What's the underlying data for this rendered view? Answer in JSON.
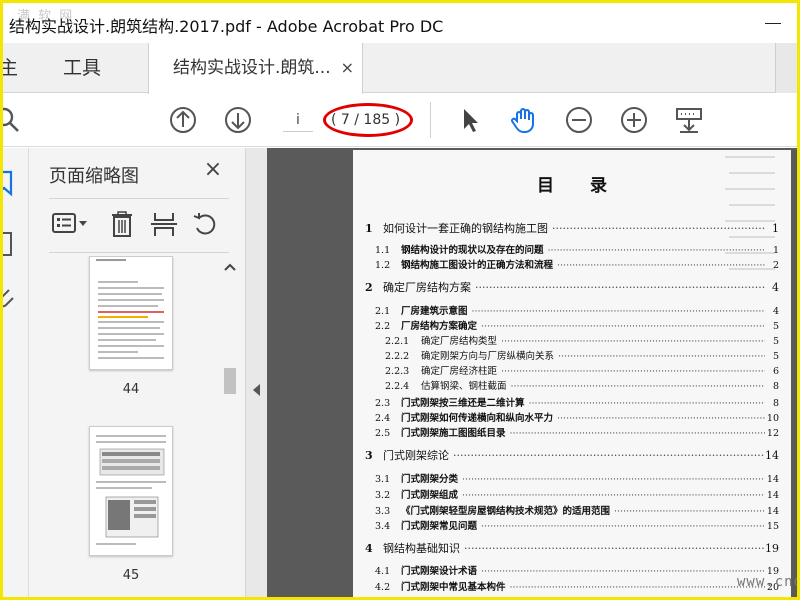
{
  "window": {
    "title": "结构实战设计.朗筑结构.2017.pdf - Adobe Acrobat Pro DC",
    "watermark": "满 软 网"
  },
  "tabs": {
    "home": "主页",
    "tools": "工具",
    "document": "结构实战设计.朗筑...",
    "close_glyph": "×"
  },
  "toolbar": {
    "page_input": "i",
    "page_count": "( 7 / 185 )"
  },
  "thumbnails": {
    "panel_title": "页面缩略图",
    "close_glyph": "×",
    "pages": [
      {
        "number": "44"
      },
      {
        "number": "45"
      }
    ]
  },
  "document": {
    "heading": "目录",
    "toc": [
      {
        "num": "1",
        "text": "如何设计一套正确的钢结构施工图",
        "page": "1",
        "level": 0
      },
      {
        "num": "1.1",
        "text": "钢结构设计的现状以及存在的问题",
        "page": "1",
        "level": 1
      },
      {
        "num": "1.2",
        "text": "钢结构施工图设计的正确方法和流程",
        "page": "2",
        "level": 1
      },
      {
        "num": "2",
        "text": "确定厂房结构方案",
        "page": "4",
        "level": 0
      },
      {
        "num": "2.1",
        "text": "厂房建筑示意图",
        "page": "4",
        "level": 1
      },
      {
        "num": "2.2",
        "text": "厂房结构方案确定",
        "page": "5",
        "level": 1
      },
      {
        "num": "2.2.1",
        "text": "确定厂房结构类型",
        "page": "5",
        "level": 2
      },
      {
        "num": "2.2.2",
        "text": "确定刚架方向与厂房纵横向关系",
        "page": "5",
        "level": 2
      },
      {
        "num": "2.2.3",
        "text": "确定厂房经济柱距",
        "page": "6",
        "level": 2
      },
      {
        "num": "2.2.4",
        "text": "估算钢梁、钢柱截面",
        "page": "8",
        "level": 2
      },
      {
        "num": "2.3",
        "text": "门式刚架按三维还是二维计算",
        "page": "8",
        "level": 1
      },
      {
        "num": "2.4",
        "text": "门式刚架如何传递横向和纵向水平力",
        "page": "10",
        "level": 1
      },
      {
        "num": "2.5",
        "text": "门式刚架施工图图纸目录",
        "page": "12",
        "level": 1
      },
      {
        "num": "3",
        "text": "门式刚架综论",
        "page": "14",
        "level": 0
      },
      {
        "num": "3.1",
        "text": "门式刚架分类",
        "page": "14",
        "level": 1
      },
      {
        "num": "3.2",
        "text": "门式刚架组成",
        "page": "14",
        "level": 1
      },
      {
        "num": "3.3",
        "text": "《门式刚架轻型房屋钢结构技术规范》的适用范围",
        "page": "14",
        "level": 1
      },
      {
        "num": "3.4",
        "text": "门式刚架常见问题",
        "page": "15",
        "level": 1
      },
      {
        "num": "4",
        "text": "钢结构基础知识",
        "page": "19",
        "level": 0
      },
      {
        "num": "4.1",
        "text": "门式刚架设计术语",
        "page": "19",
        "level": 1
      },
      {
        "num": "4.2",
        "text": "门式刚架中常见基本构件",
        "page": "20",
        "level": 1
      }
    ],
    "watermark": "www.cndao.com"
  }
}
